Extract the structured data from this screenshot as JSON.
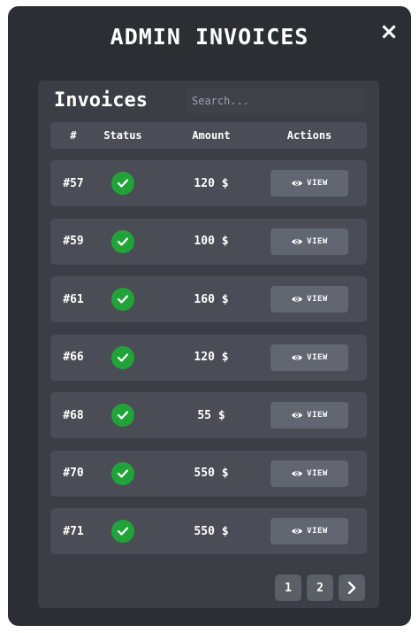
{
  "modal": {
    "title": "ADMIN INVOICES",
    "close_icon": "close-icon"
  },
  "panel": {
    "heading": "Invoices",
    "search_placeholder": "Search..."
  },
  "table": {
    "headers": {
      "number": "#",
      "status": "Status",
      "amount": "Amount",
      "actions": "Actions"
    },
    "rows": [
      {
        "number": "#57",
        "status": "paid",
        "amount": "120 $",
        "action": "VIEW"
      },
      {
        "number": "#59",
        "status": "paid",
        "amount": "100 $",
        "action": "VIEW"
      },
      {
        "number": "#61",
        "status": "paid",
        "amount": "160 $",
        "action": "VIEW"
      },
      {
        "number": "#66",
        "status": "paid",
        "amount": "120 $",
        "action": "VIEW"
      },
      {
        "number": "#68",
        "status": "paid",
        "amount": "55 $",
        "action": "VIEW"
      },
      {
        "number": "#70",
        "status": "paid",
        "amount": "550 $",
        "action": "VIEW"
      },
      {
        "number": "#71",
        "status": "paid",
        "amount": "550 $",
        "action": "VIEW"
      }
    ]
  },
  "pagination": {
    "pages": [
      "1",
      "2"
    ],
    "next_icon": "chevron-right-icon"
  },
  "icons": {
    "status": "check-circle-icon",
    "view": "eye-icon"
  },
  "colors": {
    "modal_bg": "#2b2e33",
    "panel_bg": "#3b3e45",
    "row_bg": "#4a4d55",
    "status_ok": "#22a33a",
    "button_bg": "#626670"
  }
}
